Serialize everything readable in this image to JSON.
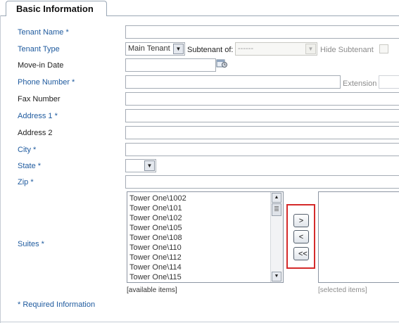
{
  "tab": {
    "title": "Basic Information"
  },
  "fields": {
    "tenant_name": {
      "label": "Tenant Name *",
      "value": ""
    },
    "tenant_type": {
      "label": "Tenant Type",
      "value": "Main Tenant"
    },
    "subtenant_of": {
      "label": "Subtenant of:",
      "value": "------"
    },
    "hide_subtenant": {
      "label": "Hide Subtenant",
      "checked": false
    },
    "move_in_date": {
      "label": "Move-in Date",
      "value": ""
    },
    "phone_number": {
      "label": "Phone Number *",
      "value": ""
    },
    "extension": {
      "label": "Extension",
      "value": ""
    },
    "fax_number": {
      "label": "Fax Number",
      "value": ""
    },
    "address1": {
      "label": "Address 1 *",
      "value": ""
    },
    "address2": {
      "label": "Address 2",
      "value": ""
    },
    "city": {
      "label": "City *",
      "value": ""
    },
    "state": {
      "label": "State *",
      "value": ""
    },
    "zip": {
      "label": "Zip *",
      "value": ""
    },
    "suites": {
      "label": "Suites *"
    }
  },
  "suites": {
    "available_items": [
      "Tower One\\1002",
      "Tower One\\101",
      "Tower One\\102",
      "Tower One\\105",
      "Tower One\\108",
      "Tower One\\110",
      "Tower One\\112",
      "Tower One\\114",
      "Tower One\\115"
    ],
    "available_caption": "[available items]",
    "selected_caption": "[selected items]",
    "buttons": {
      "add": ">",
      "remove": "<",
      "remove_all": "<<"
    }
  },
  "footnote": "* Required Information",
  "colors": {
    "required_label": "#1e5a9e",
    "highlight_border": "#d42a2a"
  }
}
